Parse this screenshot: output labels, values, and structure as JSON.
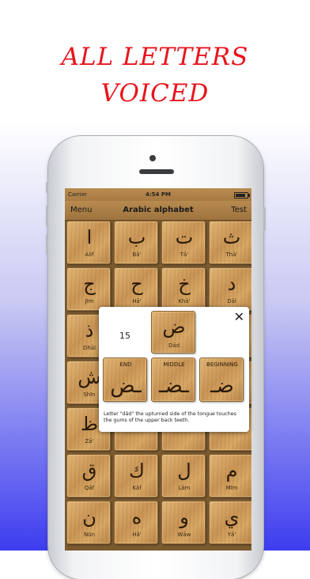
{
  "promo": {
    "line1": "ALL LETTERS",
    "line2": "VOICED"
  },
  "status_bar": {
    "carrier": "Carrier",
    "time": "4:54 PM"
  },
  "navbar": {
    "left_label": "Menu",
    "title": "Arabic alphabet",
    "right_label": "Test"
  },
  "letters": [
    {
      "glyph": "ا",
      "name": "Alif"
    },
    {
      "glyph": "ب",
      "name": "Bā'"
    },
    {
      "glyph": "ت",
      "name": "Tā'"
    },
    {
      "glyph": "ث",
      "name": "Thā'"
    },
    {
      "glyph": "ج",
      "name": "Jīm"
    },
    {
      "glyph": "ح",
      "name": "Hā'"
    },
    {
      "glyph": "خ",
      "name": "Khā'"
    },
    {
      "glyph": "د",
      "name": "Dāl"
    },
    {
      "glyph": "ذ",
      "name": "Dhāl"
    },
    {
      "glyph": "",
      "name": ""
    },
    {
      "glyph": "",
      "name": ""
    },
    {
      "glyph": "",
      "name": ""
    },
    {
      "glyph": "ش",
      "name": "Shīn"
    },
    {
      "glyph": "",
      "name": ""
    },
    {
      "glyph": "",
      "name": ""
    },
    {
      "glyph": "",
      "name": ""
    },
    {
      "glyph": "ظ",
      "name": "Zā'"
    },
    {
      "glyph": "",
      "name": ""
    },
    {
      "glyph": "",
      "name": ""
    },
    {
      "glyph": "",
      "name": ""
    },
    {
      "glyph": "ق",
      "name": "Qāf"
    },
    {
      "glyph": "ك",
      "name": "Kāf"
    },
    {
      "glyph": "ل",
      "name": "Lām"
    },
    {
      "glyph": "م",
      "name": "Mīm"
    },
    {
      "glyph": "ن",
      "name": "Nūn"
    },
    {
      "glyph": "ه",
      "name": "Hā'"
    },
    {
      "glyph": "و",
      "name": "Wāw"
    },
    {
      "glyph": "ي",
      "name": "Yā'"
    }
  ],
  "popup": {
    "close_icon": "close-icon",
    "number": "15",
    "letter": {
      "glyph": "ض",
      "name": "Dād"
    },
    "forms": [
      {
        "label": "END",
        "glyph": "ـض"
      },
      {
        "label": "MIDDLE",
        "glyph": "ـضـ"
      },
      {
        "label": "BEGINNING",
        "glyph": "ضـ"
      }
    ],
    "description": "Letter \"dād\" the upturned side of the tongue touches the gums of the upper back teeth."
  }
}
